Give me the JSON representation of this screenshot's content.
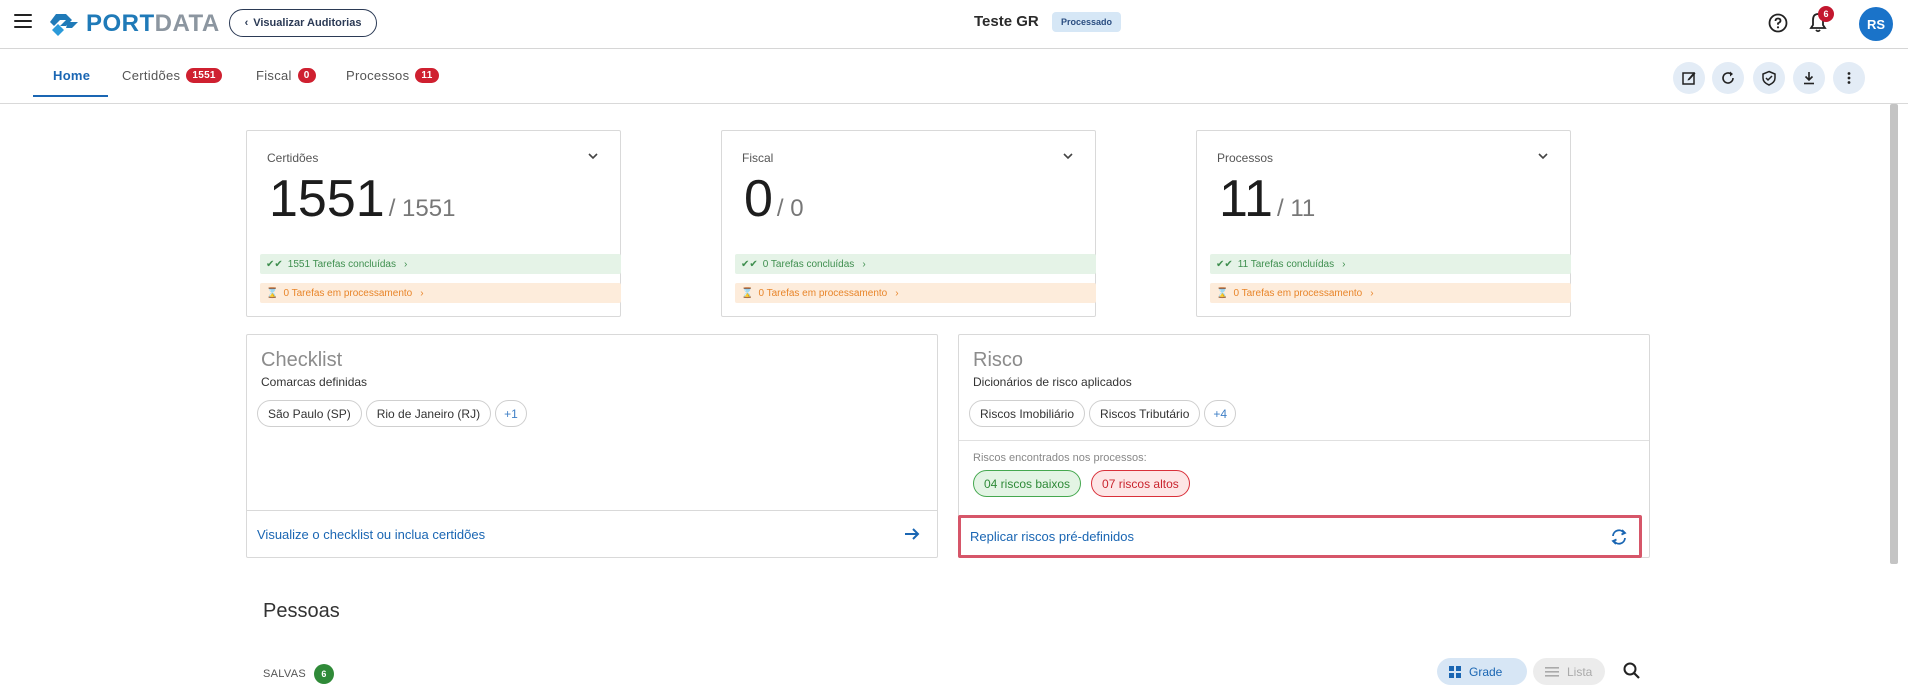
{
  "header": {
    "logo_port": "PORT",
    "logo_data": "DATA",
    "back_label": "Visualizar Auditorias",
    "title": "Teste GR",
    "status": "Processado",
    "notification_count": "6",
    "avatar_initials": "RS",
    "brand_color": "#1f7ab8"
  },
  "tabs": [
    {
      "label": "Home",
      "count": ""
    },
    {
      "label": "Certidões",
      "count": "1551"
    },
    {
      "label": "Fiscal",
      "count": "0"
    },
    {
      "label": "Processos",
      "count": "11"
    }
  ],
  "toolbar_icons": [
    "edit-icon",
    "refresh-icon",
    "shield-check-icon",
    "download-icon",
    "more-vertical-icon"
  ],
  "stats": [
    {
      "label": "Certidões",
      "value": "1551",
      "total": "/ 1551",
      "done": "1551 Tarefas concluídas",
      "processing": "0 Tarefas em processamento"
    },
    {
      "label": "Fiscal",
      "value": "0",
      "total": "/ 0",
      "done": "0 Tarefas concluídas",
      "processing": "0 Tarefas em processamento"
    },
    {
      "label": "Processos",
      "value": "11",
      "total": "/ 11",
      "done": "11 Tarefas concluídas",
      "processing": "0 Tarefas em processamento"
    }
  ],
  "checklist": {
    "title": "Checklist",
    "subtitle": "Comarcas definidas",
    "chips": [
      "São Paulo (SP)",
      "Rio de Janeiro (RJ)"
    ],
    "more": "+1",
    "footer_link": "Visualize o checklist ou inclua certidões"
  },
  "risco": {
    "title": "Risco",
    "subtitle": "Dicionários de risco aplicados",
    "chips": [
      "Riscos Imobiliário",
      "Riscos Tributário"
    ],
    "more": "+4",
    "found_label": "Riscos encontrados nos processos:",
    "low": "04 riscos baixos",
    "high": "07 riscos altos",
    "footer_link": "Replicar riscos pré-definidos"
  },
  "pessoas": {
    "title": "Pessoas",
    "saved_label": "SALVAS",
    "saved_count": "6",
    "grid_label": "Grade",
    "list_label": "Lista"
  }
}
